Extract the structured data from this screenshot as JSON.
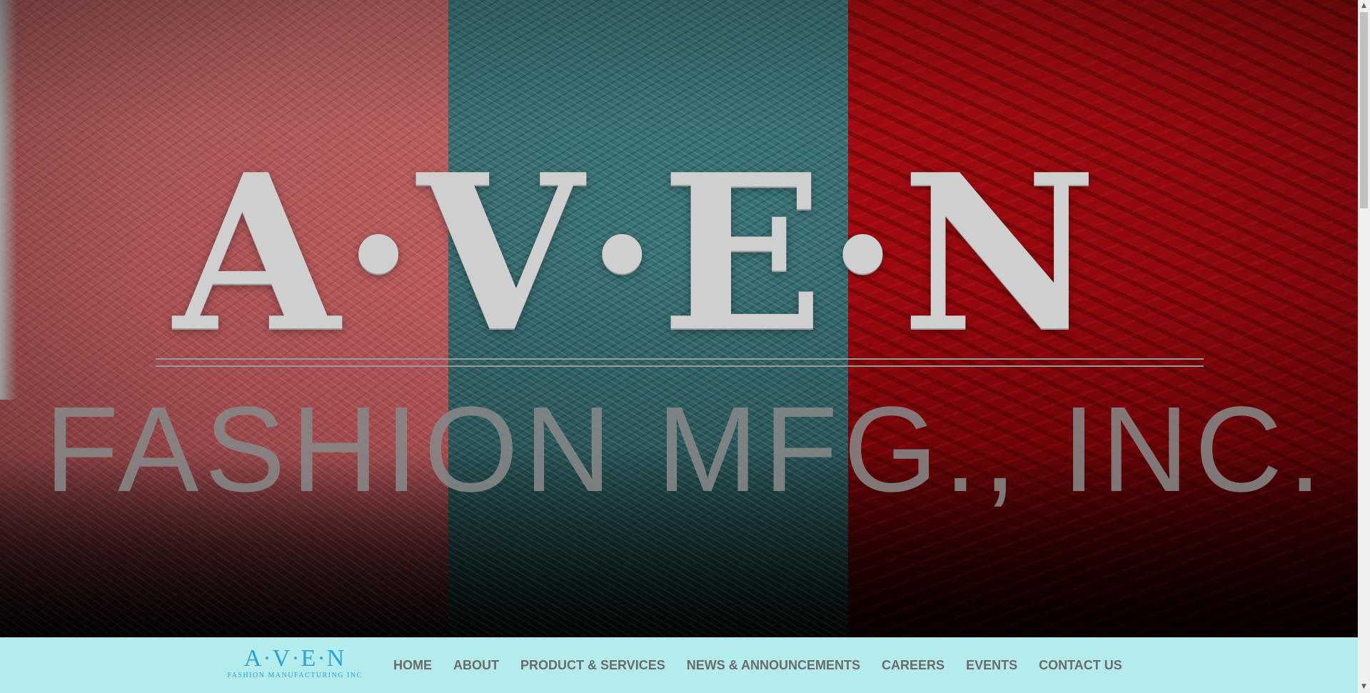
{
  "hero": {
    "logo_mark": "A·V·E·N",
    "logo_subtitle": "FASHION MFG., INC."
  },
  "header": {
    "brand_mark": "A·V·E·N",
    "brand_tagline": "FASHION MANUFACTURING INC"
  },
  "nav": {
    "items": [
      {
        "label": "HOME"
      },
      {
        "label": "ABOUT"
      },
      {
        "label": "PRODUCT & SERVICES"
      },
      {
        "label": "NEWS & ANNOUNCEMENTS"
      },
      {
        "label": "CAREERS"
      },
      {
        "label": "EVENTS"
      },
      {
        "label": "CONTACT US"
      }
    ]
  },
  "scrollbar": {
    "up_icon": "▲",
    "down_icon": "▼"
  },
  "colors": {
    "navbar_bg": "#b4ebed",
    "brand": "#2aa3db",
    "nav_text": "#6b6b6b"
  }
}
